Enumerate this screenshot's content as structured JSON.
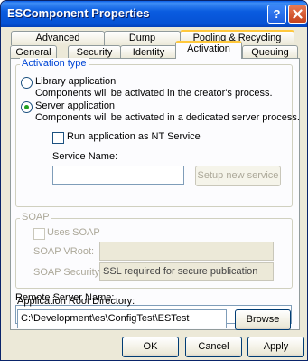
{
  "window": {
    "title": "ESComponent Properties",
    "help_label": "?"
  },
  "tabs_row1": [
    {
      "label": "Advanced"
    },
    {
      "label": "Dump"
    },
    {
      "label": "Pooling & Recycling"
    }
  ],
  "tabs_row2": [
    {
      "label": "General"
    },
    {
      "label": "Security"
    },
    {
      "label": "Identity"
    },
    {
      "label": "Activation",
      "selected": true
    },
    {
      "label": "Queuing"
    }
  ],
  "activation": {
    "group_title": "Activation type",
    "library_label": "Library application",
    "library_desc": "Components will be activated in the creator's process.",
    "server_label": "Server application",
    "server_desc": "Components will be activated in a dedicated server process.",
    "selected": "server",
    "nt_service_label": "Run application as NT Service",
    "nt_service_checked": false,
    "service_name_label": "Service Name:",
    "service_name_value": "",
    "setup_service_label": "Setup new service"
  },
  "soap": {
    "group_title": "SOAP",
    "uses_soap_label": "Uses SOAP",
    "vroot_label": "SOAP VRoot:",
    "vroot_value": "",
    "security_label": "SOAP Security:",
    "security_value": "SSL required for secure publication"
  },
  "remote": {
    "label": "Remote Server Name:",
    "value": ""
  },
  "app_root": {
    "label": "Application Root Directory:",
    "value": "C:\\Development\\es\\ConfigTest\\ESTest",
    "browse_label": "Browse"
  },
  "footer": {
    "ok_label": "OK",
    "cancel_label": "Cancel",
    "apply_label": "Apply"
  },
  "colors": {
    "titlebar": "#0a5ce0",
    "group_title": "#0046d5",
    "tab_accent": "#ffc83c",
    "close_button": "#c5411b"
  }
}
